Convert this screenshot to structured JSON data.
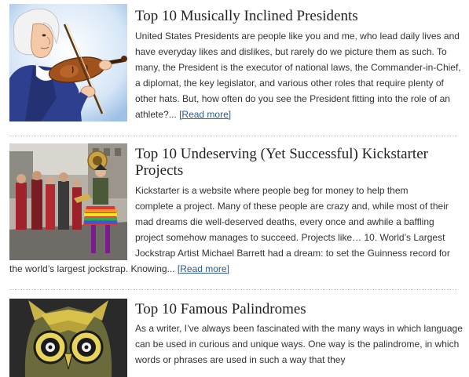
{
  "posts": [
    {
      "title": "Top 10 Musically Inclined Presidents",
      "excerpt": "United States Presidents are people like you and me, who lead daily lives and have everyday likes and dislikes, but rarely do we picture them as such. To many, the President is the executor of national laws, the Commander-in-Chief, a diplomat, the key legislator, and various other roles that require plenty of other hats. But, how often do you see the President fitting into the role of an athlete?...",
      "more_label": "[Read more]"
    },
    {
      "title": "Top 10 Undeserving (Yet Successful) Kickstarter Projects",
      "excerpt_lines": [
        "Kickstarter is a website where people beg for money to help them",
        "complete a project. Many of these people are crazy and, while most of their",
        "mad dreams die well-deserved deaths, every once and awhile a baffling",
        "project somehow manages to succeed. Projects like…  10. World’s Largest",
        "Jockstrap Artist Michael Barrett had a dream: to set the Guinness record for",
        "the world’s largest jockstrap. Knowing..."
      ],
      "more_label": "[Read more]"
    },
    {
      "title": "Top 10 Famous Palindromes",
      "excerpt": "As a writer, I’ve always been fascinated with the many ways in which language can be used in curious and unique ways. One way is the palindrome, in which words or phrases are used in such a way that they"
    }
  ]
}
